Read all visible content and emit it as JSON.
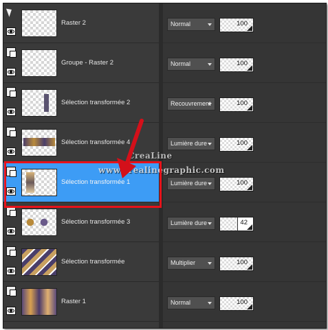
{
  "layers": [
    {
      "name": "Raster 2",
      "selected": false,
      "blend": "Normal",
      "opacity": "100"
    },
    {
      "name": "Groupe - Raster 2",
      "selected": false,
      "blend": "Normal",
      "opacity": "100"
    },
    {
      "name": "Sélection transformée 2",
      "selected": false,
      "blend": "Recouvrement",
      "opacity": "100"
    },
    {
      "name": "Sélection transformée 4",
      "selected": false,
      "blend": "Lumière dure",
      "opacity": "100"
    },
    {
      "name": "Sélection transformée 1",
      "selected": true,
      "blend": "Lumière dure",
      "opacity": "100"
    },
    {
      "name": "Sélection transformée 3",
      "selected": false,
      "blend": "Lumière dure",
      "opacity": "42"
    },
    {
      "name": "Sélection transformée",
      "selected": false,
      "blend": "Multiplier",
      "opacity": "100"
    },
    {
      "name": "Raster 1",
      "selected": false,
      "blend": "Normal",
      "opacity": "100"
    }
  ],
  "watermark": {
    "line1": "CreaLine",
    "line2": "www.crealinegraphic.com"
  },
  "colors": {
    "selected": "#3d9cf5",
    "highlight": "#e8121a",
    "panel": "#3a3a3a"
  }
}
